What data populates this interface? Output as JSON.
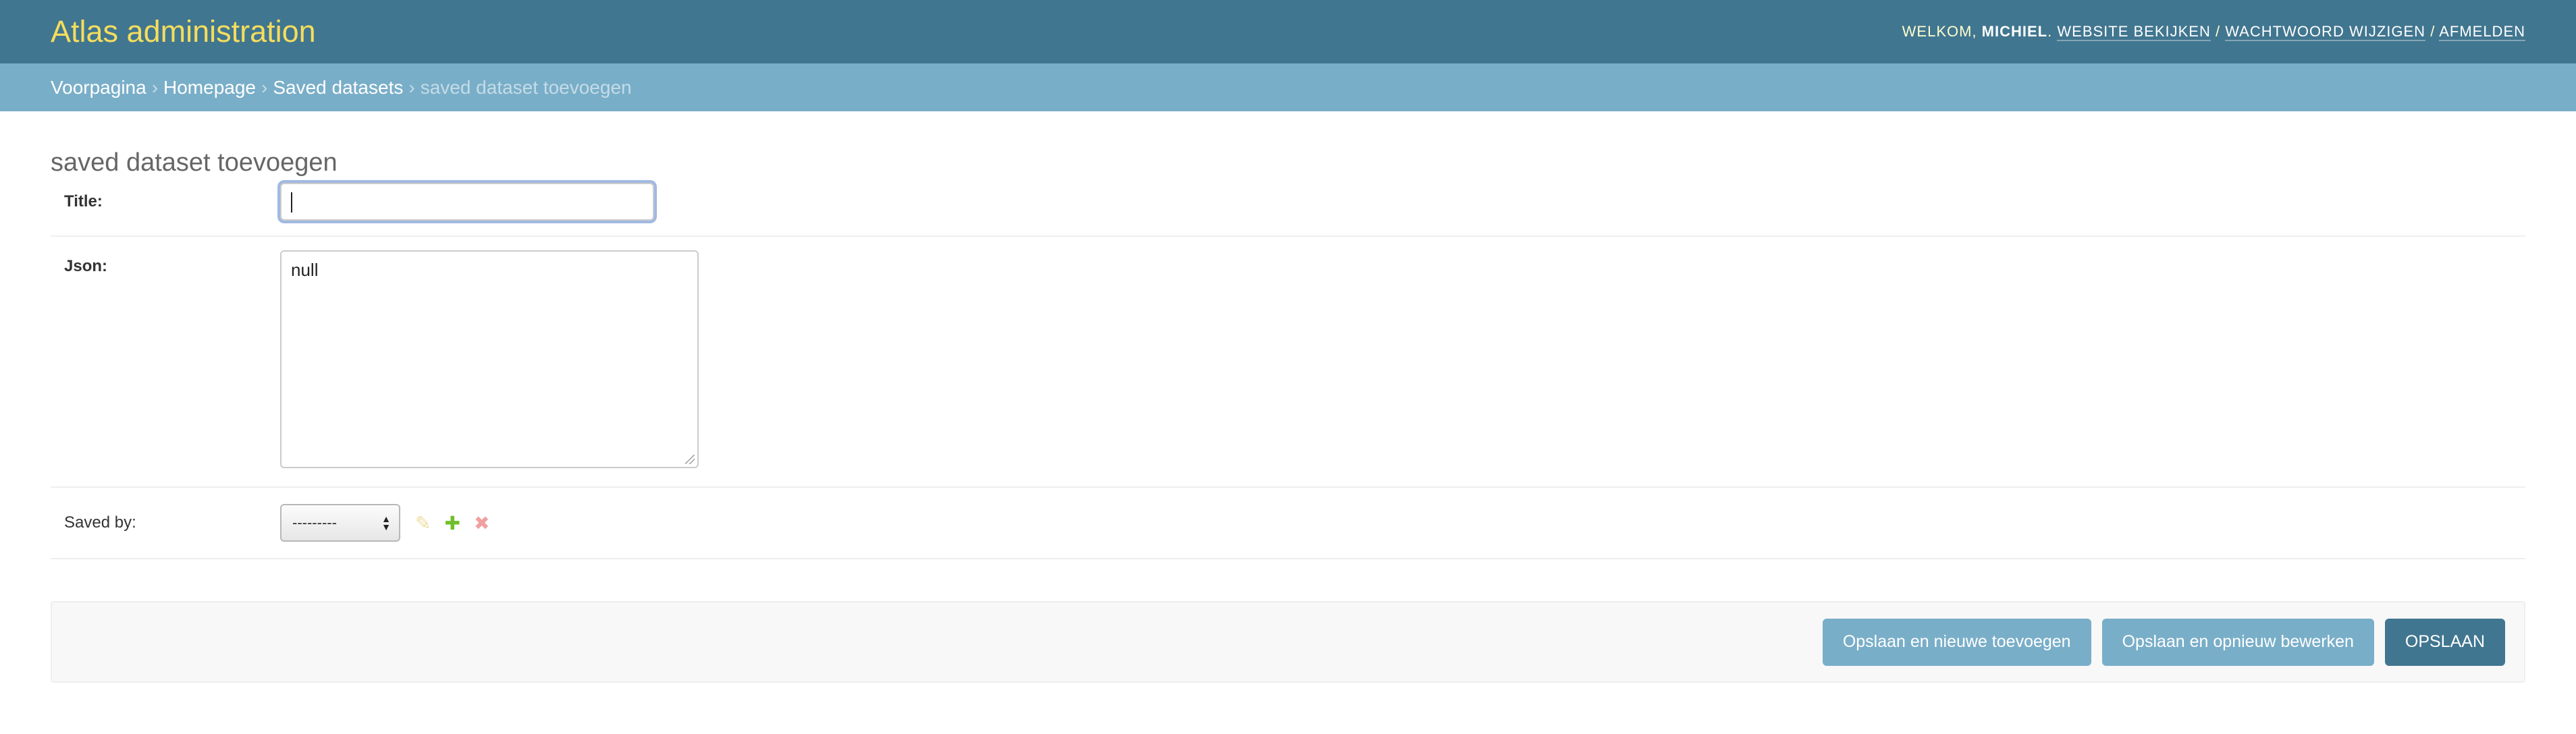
{
  "header": {
    "site_title": "Atlas administration",
    "welcome": "Welkom,",
    "username": "Michiel",
    "links": [
      "Website bekijken",
      "Wachtwoord wijzigen",
      "Afmelden"
    ]
  },
  "breadcrumbs": {
    "items": [
      "Voorpagina",
      "Homepage",
      "Saved datasets"
    ],
    "current": "saved dataset toevoegen",
    "separator": "›"
  },
  "page": {
    "title": "saved dataset toevoegen"
  },
  "form": {
    "title_label": "Title:",
    "title_value": "",
    "json_label": "Json:",
    "json_value": "null",
    "saved_by_label": "Saved by:",
    "saved_by_selected": "---------"
  },
  "actions": {
    "save_add": "Opslaan en nieuwe toevoegen",
    "save_continue": "Opslaan en opnieuw bewerken",
    "save": "Opslaan"
  },
  "icons": {
    "edit": "pencil-icon",
    "add": "plus-icon",
    "delete": "x-icon"
  },
  "colors": {
    "header_bg": "#417690",
    "breadcrumb_bg": "#79aec8",
    "brand_yellow": "#f5dd5d"
  }
}
